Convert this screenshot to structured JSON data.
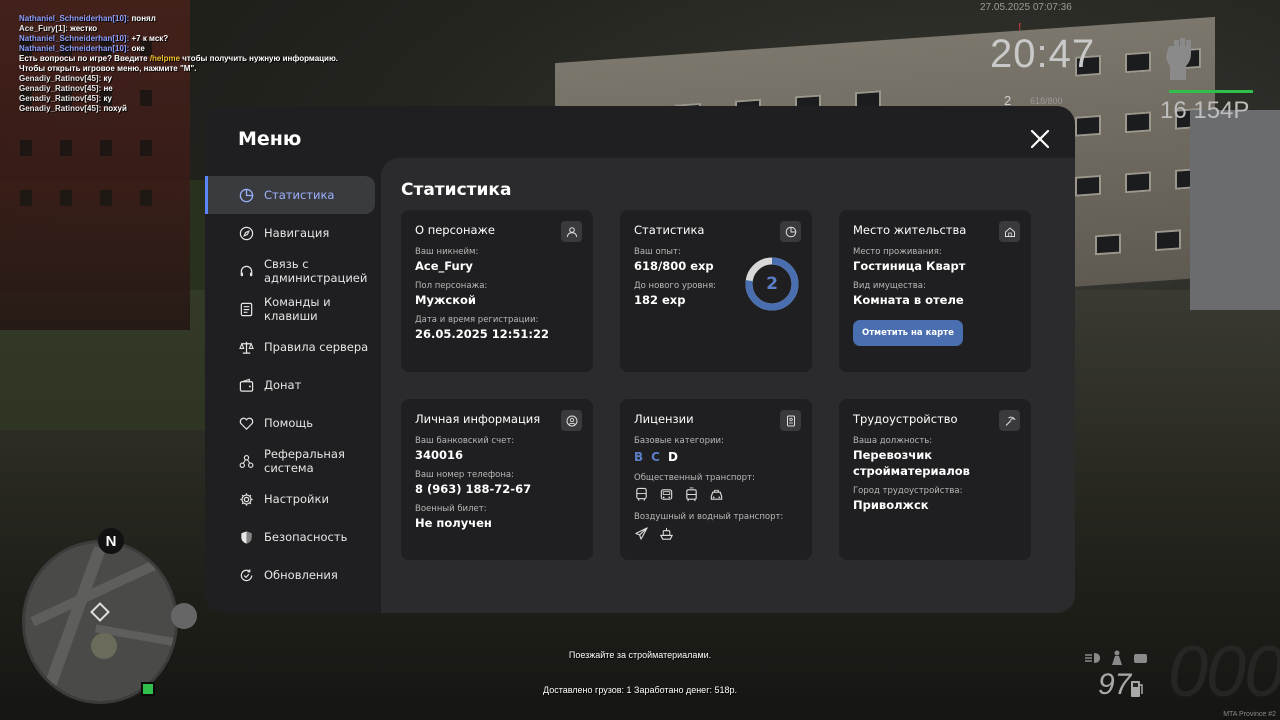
{
  "chat": [
    {
      "nick": "Nathaniel_Schneiderhan[10]:",
      "msg": " понял",
      "nick_color": "blue"
    },
    {
      "nick": "Ace_Fury[1]:",
      "msg": " жестко",
      "nick_color": "white"
    },
    {
      "nick": "Nathaniel_Schneiderhan[10]:",
      "msg": " +7 к мск?",
      "nick_color": "blue"
    },
    {
      "nick": "Nathaniel_Schneiderhan[10]:",
      "msg": " оке",
      "nick_color": "blue"
    }
  ],
  "chat_help": {
    "pre": "Есть вопросы по игре? Введите ",
    "cmd": "/helpme",
    "post": " чтобы получить нужную информацию."
  },
  "chat_menu_hint": "Чтобы открыть игровое меню, нажмите \"M\".",
  "chat2": [
    {
      "nick": "Genadiy_Ratinov[45]:",
      "msg": " ку"
    },
    {
      "nick": "Genadiy_Ratinov[45]:",
      "msg": " не"
    },
    {
      "nick": "Genadiy_Ratinov[45]:",
      "msg": " ку"
    },
    {
      "nick": "Genadiy_Ratinov[45]:",
      "msg": " похуй"
    }
  ],
  "hud": {
    "date": "27.05.2025 07:07:36",
    "time": "20:47",
    "level": "2",
    "exp": "618/800",
    "money": "16 154Р",
    "red_mark": "!",
    "fuel": "97",
    "speed": "000",
    "watermark": "MTA Province #2",
    "compass": "N"
  },
  "task": {
    "hint": "Поезжайте за стройматериалами.",
    "stats": "Доставлено грузов: 1 Заработано денег: 518р."
  },
  "menu": {
    "title": "Меню",
    "sidebar": [
      {
        "label": "Статистика",
        "icon": "pie-chart-icon",
        "active": true
      },
      {
        "label": "Навигация",
        "icon": "compass-icon"
      },
      {
        "label": "Связь с администрацией",
        "icon": "headset-icon"
      },
      {
        "label": "Команды и клавиши",
        "icon": "document-list-icon"
      },
      {
        "label": "Правила сервера",
        "icon": "scales-icon"
      },
      {
        "label": "Донат",
        "icon": "wallet-icon"
      },
      {
        "label": "Помощь",
        "icon": "handshake-heart-icon"
      },
      {
        "label": "Реферальная система",
        "icon": "referral-nodes-icon"
      },
      {
        "label": "Настройки",
        "icon": "gear-icon"
      },
      {
        "label": "Безопасность",
        "icon": "shield-icon"
      },
      {
        "label": "Обновления",
        "icon": "refresh-check-icon"
      }
    ],
    "content_title": "Статистика",
    "cards": {
      "character": {
        "title": "О персонаже",
        "icon": "user-icon",
        "nick_label": "Ваш никнейм:",
        "nick": "Ace_Fury",
        "gender_label": "Пол персонажа:",
        "gender": "Мужской",
        "reg_label": "Дата и время регистрации:",
        "reg": "26.05.2025 12:51:22"
      },
      "stats": {
        "title": "Статистика",
        "icon": "pie-chart-icon",
        "exp_label": "Ваш опыт:",
        "exp": "618/800 exp",
        "next_label": "До нового уровня:",
        "next": "182 exp",
        "level": "2",
        "progress": 0.7725,
        "ring_color": "#4a6fb0"
      },
      "residence": {
        "title": "Место жительства",
        "icon": "house-icon",
        "place_label": "Место проживания:",
        "place": "Гостиница Кварт",
        "type_label": "Вид имущества:",
        "type": "Комната в отеле",
        "button": "Отметить на карте"
      },
      "personal": {
        "title": "Личная информация",
        "icon": "user-circle-icon",
        "bank_label": "Ваш банковский счет:",
        "bank": "340016",
        "phone_label": "Ваш номер телефона:",
        "phone": "8 (963) 188-72-67",
        "military_label": "Военный билет:",
        "military": "Не получен"
      },
      "licenses": {
        "title": "Лицензии",
        "icon": "id-card-icon",
        "base_label": "Базовые категории:",
        "categories": [
          "B",
          "C",
          "D"
        ],
        "public_label": "Общественный транспорт:",
        "air_label": "Воздушный и водный транспорт:"
      },
      "job": {
        "title": "Трудоустройство",
        "icon": "pickaxe-icon",
        "position_label": "Ваша должность:",
        "position": "Перевозчик стройматериалов",
        "city_label": "Город трудоустройства:",
        "city": "Приволжск"
      }
    }
  }
}
